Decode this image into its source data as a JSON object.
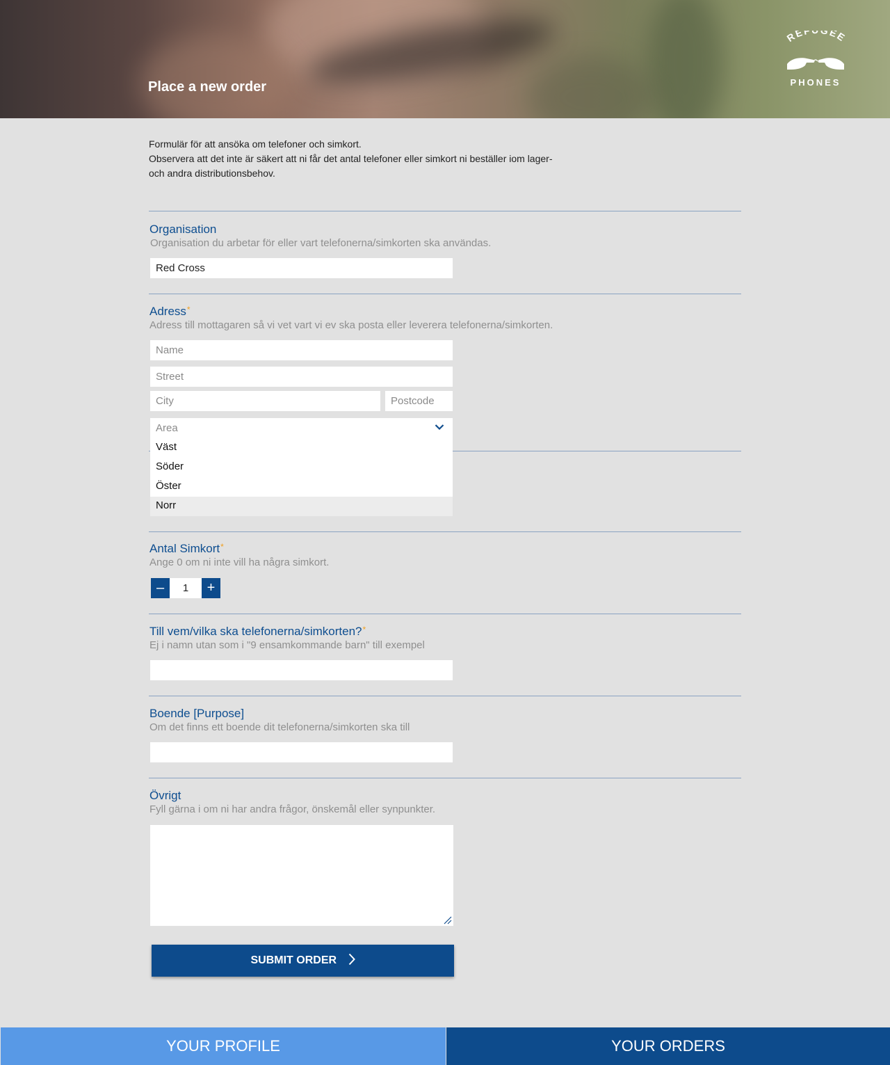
{
  "header": {
    "title": "Place a new order",
    "logo_top_text": "REFUGEE",
    "logo_bottom_text": "PHONES"
  },
  "intro": {
    "line1": "Formulär för att ansöka om telefoner och simkort.",
    "line2": "Observera att det inte är säkert att ni får det antal telefoner eller simkort ni beställer iom lager-",
    "line3": "och andra distributionsbehov."
  },
  "organisation": {
    "label": "Organisation",
    "help": "Organisation du arbetar för eller vart telefonerna/simkorten ska användas.",
    "value": "Red Cross"
  },
  "address": {
    "label": "Adress",
    "required_mark": "*",
    "help": "Adress till mottagaren så vi vet vart vi ev ska posta eller leverera telefonerna/simkorten.",
    "name_placeholder": "Name",
    "street_placeholder": "Street",
    "city_placeholder": "City",
    "postcode_placeholder": "Postcode",
    "area_placeholder": "Area",
    "area_options": [
      "Väst",
      "Söder",
      "Öster",
      "Norr"
    ]
  },
  "simcards": {
    "label": "Antal Simkort",
    "required_mark": "*",
    "help": "Ange 0 om ni inte vill ha några simkort.",
    "value": "1",
    "minus": "–",
    "plus": "+"
  },
  "recipients": {
    "label": "Till vem/vilka ska telefonerna/simkorten?",
    "required_mark": "*",
    "help": "Ej i namn utan som i \"9 ensamkommande barn\" till exempel",
    "value": ""
  },
  "boende": {
    "label": "Boende [Purpose]",
    "help": "Om det finns ett boende dit telefonerna/simkorten ska till",
    "value": ""
  },
  "other": {
    "label": "Övrigt",
    "help": "Fyll gärna i om ni har andra frågor, önskemål eller synpunkter.",
    "value": ""
  },
  "submit_label": "SUBMIT ORDER",
  "tabs": {
    "profile": "YOUR PROFILE",
    "orders": "YOUR ORDERS"
  },
  "colors": {
    "primary": "#0d4b8c",
    "accent_tab": "#5899e6",
    "required": "#f0a020",
    "background": "#e1e1e1"
  },
  "icons": {
    "area_select": "chevron-down-icon",
    "submit": "chevron-right-icon",
    "textarea": "resize-handle-icon"
  }
}
